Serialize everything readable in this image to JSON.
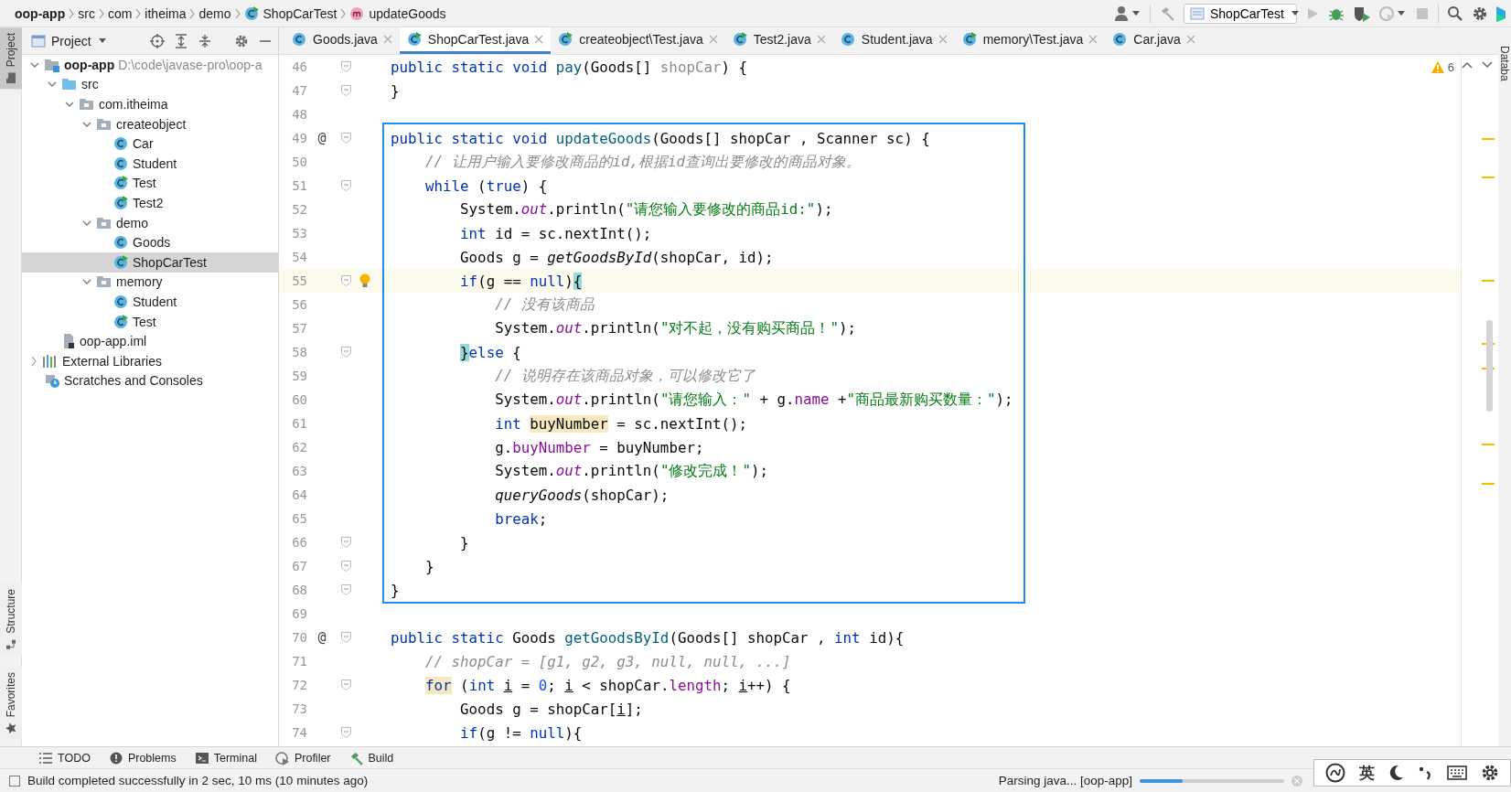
{
  "breadcrumb": [
    {
      "label": "oop-app",
      "kind": "project"
    },
    {
      "label": "src",
      "kind": "folder"
    },
    {
      "label": "com",
      "kind": "folder"
    },
    {
      "label": "itheima",
      "kind": "folder"
    },
    {
      "label": "demo",
      "kind": "folder"
    },
    {
      "label": "ShopCarTest",
      "kind": "runnable-class"
    },
    {
      "label": "updateGoods",
      "kind": "method"
    }
  ],
  "toolbar": {
    "run_config": "ShopCarTest"
  },
  "left_strip_top": [
    {
      "label": "Project",
      "selected": true
    }
  ],
  "left_strip_bottom": [
    {
      "label": "Structure",
      "selected": false
    },
    {
      "label": "Favorites",
      "selected": false
    }
  ],
  "right_strip": [
    {
      "label": "Databa"
    }
  ],
  "project_panel": {
    "title": "Project",
    "tree": [
      {
        "label": "oop-app",
        "path": "D:\\code\\javase-pro\\oop-a",
        "kind": "module",
        "expanded": true,
        "selected": false,
        "children": [
          {
            "label": "src",
            "kind": "source-folder",
            "expanded": true,
            "selected": false,
            "children": [
              {
                "label": "com.itheima",
                "kind": "package",
                "expanded": true,
                "selected": false,
                "children": [
                  {
                    "label": "createobject",
                    "kind": "package",
                    "expanded": true,
                    "selected": false,
                    "children": [
                      {
                        "label": "Car",
                        "kind": "class",
                        "selected": false
                      },
                      {
                        "label": "Student",
                        "kind": "class",
                        "selected": false
                      },
                      {
                        "label": "Test",
                        "kind": "runnable-class",
                        "selected": false
                      },
                      {
                        "label": "Test2",
                        "kind": "runnable-class",
                        "selected": false
                      }
                    ]
                  },
                  {
                    "label": "demo",
                    "kind": "package",
                    "expanded": true,
                    "selected": false,
                    "children": [
                      {
                        "label": "Goods",
                        "kind": "class",
                        "selected": false
                      },
                      {
                        "label": "ShopCarTest",
                        "kind": "runnable-class",
                        "selected": true
                      }
                    ]
                  },
                  {
                    "label": "memory",
                    "kind": "package",
                    "expanded": true,
                    "selected": false,
                    "children": [
                      {
                        "label": "Student",
                        "kind": "class",
                        "selected": false
                      },
                      {
                        "label": "Test",
                        "kind": "runnable-class",
                        "selected": false
                      }
                    ]
                  }
                ]
              }
            ]
          },
          {
            "label": "oop-app.iml",
            "kind": "iml",
            "selected": false
          }
        ]
      },
      {
        "label": "External Libraries",
        "kind": "libraries",
        "expanded": false,
        "selected": false
      },
      {
        "label": "Scratches and Consoles",
        "kind": "scratches",
        "selected": false
      }
    ]
  },
  "tabs": [
    {
      "label": "Goods.java",
      "kind": "class",
      "selected": false
    },
    {
      "label": "ShopCarTest.java",
      "kind": "runnable-class",
      "selected": true
    },
    {
      "label": "createobject\\Test.java",
      "kind": "runnable-class",
      "selected": false
    },
    {
      "label": "Test2.java",
      "kind": "runnable-class",
      "selected": false
    },
    {
      "label": "Student.java",
      "kind": "class",
      "selected": false
    },
    {
      "label": "memory\\Test.java",
      "kind": "runnable-class",
      "selected": false
    },
    {
      "label": "Car.java",
      "kind": "class",
      "selected": false
    }
  ],
  "editor": {
    "warnings": "6",
    "blocks": [
      {
        "boxed": false,
        "lines": [
          {
            "number": "46",
            "fold": true,
            "bulb": false,
            "current": false,
            "tokens": [
              {
                "kind": "kw",
                "text": "public static void "
              },
              {
                "kind": "decl",
                "text": "pay"
              },
              {
                "kind": "plain",
                "text": "(Goods[] "
              },
              {
                "kind": "unused",
                "text": "shopCar"
              },
              {
                "kind": "plain",
                "text": ") {"
              }
            ]
          },
          {
            "number": "47",
            "fold": true,
            "bulb": false,
            "current": false,
            "tokens": [
              {
                "kind": "plain",
                "text": "}"
              }
            ]
          },
          {
            "number": "48",
            "fold": false,
            "bulb": false,
            "current": false
          }
        ]
      },
      {
        "boxed": true,
        "lines": [
          {
            "number": "49",
            "gutter_mark": "@",
            "fold": true,
            "bulb": false,
            "current": false,
            "tokens": [
              {
                "kind": "kw",
                "text": "public static void "
              },
              {
                "kind": "decl",
                "text": "updateGoods"
              },
              {
                "kind": "plain",
                "text": "(Goods[] shopCar , Scanner sc) {"
              }
            ]
          },
          {
            "number": "50",
            "fold": false,
            "bulb": false,
            "current": false,
            "tokens": [
              {
                "kind": "comment",
                "text": "    // 让用户输入要修改商品的id,根据id查询出要修改的商品对象。"
              }
            ]
          },
          {
            "number": "51",
            "fold": true,
            "bulb": false,
            "current": false,
            "tokens": [
              {
                "kind": "kw",
                "text": "    while"
              },
              {
                "kind": "plain",
                "text": " ("
              },
              {
                "kind": "kw",
                "text": "true"
              },
              {
                "kind": "plain",
                "text": ") {"
              }
            ]
          },
          {
            "number": "52",
            "fold": false,
            "bulb": false,
            "current": false,
            "tokens": [
              {
                "kind": "plain",
                "text": "        System."
              },
              {
                "kind": "static",
                "text": "out"
              },
              {
                "kind": "plain",
                "text": ".println("
              },
              {
                "kind": "str",
                "text": "\"请您输入要修改的商品id:\""
              },
              {
                "kind": "plain",
                "text": ");"
              }
            ]
          },
          {
            "number": "53",
            "fold": false,
            "bulb": false,
            "current": false,
            "tokens": [
              {
                "kind": "kw",
                "text": "        int"
              },
              {
                "kind": "plain",
                "text": " id = sc.nextInt();"
              }
            ]
          },
          {
            "number": "54",
            "fold": false,
            "bulb": false,
            "current": false,
            "tokens": [
              {
                "kind": "plain",
                "text": "        Goods g = "
              },
              {
                "kind": "call",
                "text": "getGoodsById"
              },
              {
                "kind": "plain",
                "text": "(shopCar, id);"
              }
            ]
          },
          {
            "number": "55",
            "fold": true,
            "bulb": true,
            "current": true,
            "tokens": [
              {
                "kind": "kw",
                "text": "        if"
              },
              {
                "kind": "plain",
                "text": "(g == "
              },
              {
                "kind": "kw",
                "text": "null"
              },
              {
                "kind": "plain",
                "text": ")"
              },
              {
                "kind": "match",
                "text": "{"
              }
            ]
          },
          {
            "number": "56",
            "fold": false,
            "bulb": false,
            "current": false,
            "tokens": [
              {
                "kind": "comment",
                "text": "            // 没有该商品"
              }
            ]
          },
          {
            "number": "57",
            "fold": false,
            "bulb": false,
            "current": false,
            "tokens": [
              {
                "kind": "plain",
                "text": "            System."
              },
              {
                "kind": "static",
                "text": "out"
              },
              {
                "kind": "plain",
                "text": ".println("
              },
              {
                "kind": "str",
                "text": "\"对不起，没有购买商品！\""
              },
              {
                "kind": "plain",
                "text": ");"
              }
            ]
          },
          {
            "number": "58",
            "fold": true,
            "bulb": false,
            "current": false,
            "tokens": [
              {
                "kind": "match",
                "text": "        }"
              },
              {
                "kind": "kw",
                "text": "else"
              },
              {
                "kind": "plain",
                "text": " {"
              }
            ]
          },
          {
            "number": "59",
            "fold": false,
            "bulb": false,
            "current": false,
            "tokens": [
              {
                "kind": "comment",
                "text": "            // 说明存在该商品对象，可以修改它了"
              }
            ]
          },
          {
            "number": "60",
            "fold": false,
            "bulb": false,
            "current": false,
            "tokens": [
              {
                "kind": "plain",
                "text": "            System."
              },
              {
                "kind": "static",
                "text": "out"
              },
              {
                "kind": "plain",
                "text": ".println("
              },
              {
                "kind": "str",
                "text": "\"请您输入：\""
              },
              {
                "kind": "plain",
                "text": " + g."
              },
              {
                "kind": "field",
                "text": "name"
              },
              {
                "kind": "plain",
                "text": " +"
              },
              {
                "kind": "str",
                "text": "\"商品最新购买数量：\""
              },
              {
                "kind": "plain",
                "text": ");"
              }
            ]
          },
          {
            "number": "61",
            "fold": false,
            "bulb": false,
            "current": false,
            "tokens": [
              {
                "kind": "kw",
                "text": "            int "
              },
              {
                "kind": "mark",
                "text": "buyNumber"
              },
              {
                "kind": "plain",
                "text": " = sc.nextInt();"
              }
            ]
          },
          {
            "number": "62",
            "fold": false,
            "bulb": false,
            "current": false,
            "tokens": [
              {
                "kind": "plain",
                "text": "            g."
              },
              {
                "kind": "field",
                "text": "buyNumber"
              },
              {
                "kind": "plain",
                "text": " = buyNumber;"
              }
            ]
          },
          {
            "number": "63",
            "fold": false,
            "bulb": false,
            "current": false,
            "tokens": [
              {
                "kind": "plain",
                "text": "            System."
              },
              {
                "kind": "static",
                "text": "out"
              },
              {
                "kind": "plain",
                "text": ".println("
              },
              {
                "kind": "str",
                "text": "\"修改完成！\""
              },
              {
                "kind": "plain",
                "text": ");"
              }
            ]
          },
          {
            "number": "64",
            "fold": false,
            "bulb": false,
            "current": false,
            "tokens": [
              {
                "kind": "call",
                "text": "            queryGoods"
              },
              {
                "kind": "plain",
                "text": "(shopCar);"
              }
            ]
          },
          {
            "number": "65",
            "fold": false,
            "bulb": false,
            "current": false,
            "tokens": [
              {
                "kind": "kw",
                "text": "            break"
              },
              {
                "kind": "plain",
                "text": ";"
              }
            ]
          },
          {
            "number": "66",
            "fold": true,
            "bulb": false,
            "current": false,
            "tokens": [
              {
                "kind": "plain",
                "text": "        }"
              }
            ]
          },
          {
            "number": "67",
            "fold": true,
            "bulb": false,
            "current": false,
            "tokens": [
              {
                "kind": "plain",
                "text": "    }"
              }
            ]
          },
          {
            "number": "68",
            "fold": true,
            "bulb": false,
            "current": false,
            "tokens": [
              {
                "kind": "plain",
                "text": "}"
              }
            ]
          }
        ]
      },
      {
        "boxed": false,
        "lines": [
          {
            "number": "69",
            "fold": false,
            "bulb": false,
            "current": false
          },
          {
            "number": "70",
            "gutter_mark": "@",
            "fold": true,
            "bulb": false,
            "current": false,
            "tokens": [
              {
                "kind": "kw",
                "text": "public static "
              },
              {
                "kind": "plain",
                "text": "Goods "
              },
              {
                "kind": "decl",
                "text": "getGoodsById"
              },
              {
                "kind": "plain",
                "text": "(Goods[] shopCar , "
              },
              {
                "kind": "kw",
                "text": "int"
              },
              {
                "kind": "plain",
                "text": " id){"
              }
            ]
          },
          {
            "number": "71",
            "fold": false,
            "bulb": false,
            "current": false,
            "tokens": [
              {
                "kind": "comment",
                "text": "    // shopCar = [g1, g2, g3, null, null, ...]"
              }
            ]
          },
          {
            "number": "72",
            "fold": true,
            "bulb": false,
            "current": false,
            "tokens": [
              {
                "kind": "kw-mark",
                "text": "    for"
              },
              {
                "kind": "plain",
                "text": " ("
              },
              {
                "kind": "kw",
                "text": "int "
              },
              {
                "kind": "var",
                "text": "i"
              },
              {
                "kind": "plain",
                "text": " = "
              },
              {
                "kind": "num",
                "text": "0"
              },
              {
                "kind": "plain",
                "text": "; "
              },
              {
                "kind": "var",
                "text": "i"
              },
              {
                "kind": "plain",
                "text": " < shopCar."
              },
              {
                "kind": "field",
                "text": "length"
              },
              {
                "kind": "plain",
                "text": "; "
              },
              {
                "kind": "var",
                "text": "i"
              },
              {
                "kind": "plain",
                "text": "++) {"
              }
            ]
          },
          {
            "number": "73",
            "fold": false,
            "bulb": false,
            "current": false,
            "tokens": [
              {
                "kind": "plain",
                "text": "        Goods g = shopCar["
              },
              {
                "kind": "var",
                "text": "i"
              },
              {
                "kind": "plain",
                "text": "];"
              }
            ]
          },
          {
            "number": "74",
            "fold": true,
            "bulb": false,
            "current": false,
            "tokens": [
              {
                "kind": "kw",
                "text": "        if"
              },
              {
                "kind": "plain",
                "text": "(g != "
              },
              {
                "kind": "kw",
                "text": "null"
              },
              {
                "kind": "plain",
                "text": "){"
              }
            ]
          }
        ]
      }
    ]
  },
  "tool_tabs": [
    {
      "label": "TODO",
      "kind": "todo"
    },
    {
      "label": "Problems",
      "kind": "problems"
    },
    {
      "label": "Terminal",
      "kind": "terminal"
    },
    {
      "label": "Profiler",
      "kind": "profiler"
    },
    {
      "label": "Build",
      "kind": "build"
    }
  ],
  "status_bar": {
    "message": "Build completed successfully in 2 sec, 10 ms (10 minutes ago)",
    "task": "Parsing java... [oop-app]",
    "level": 0.3
  },
  "ime_bar": {
    "mode": "英"
  }
}
